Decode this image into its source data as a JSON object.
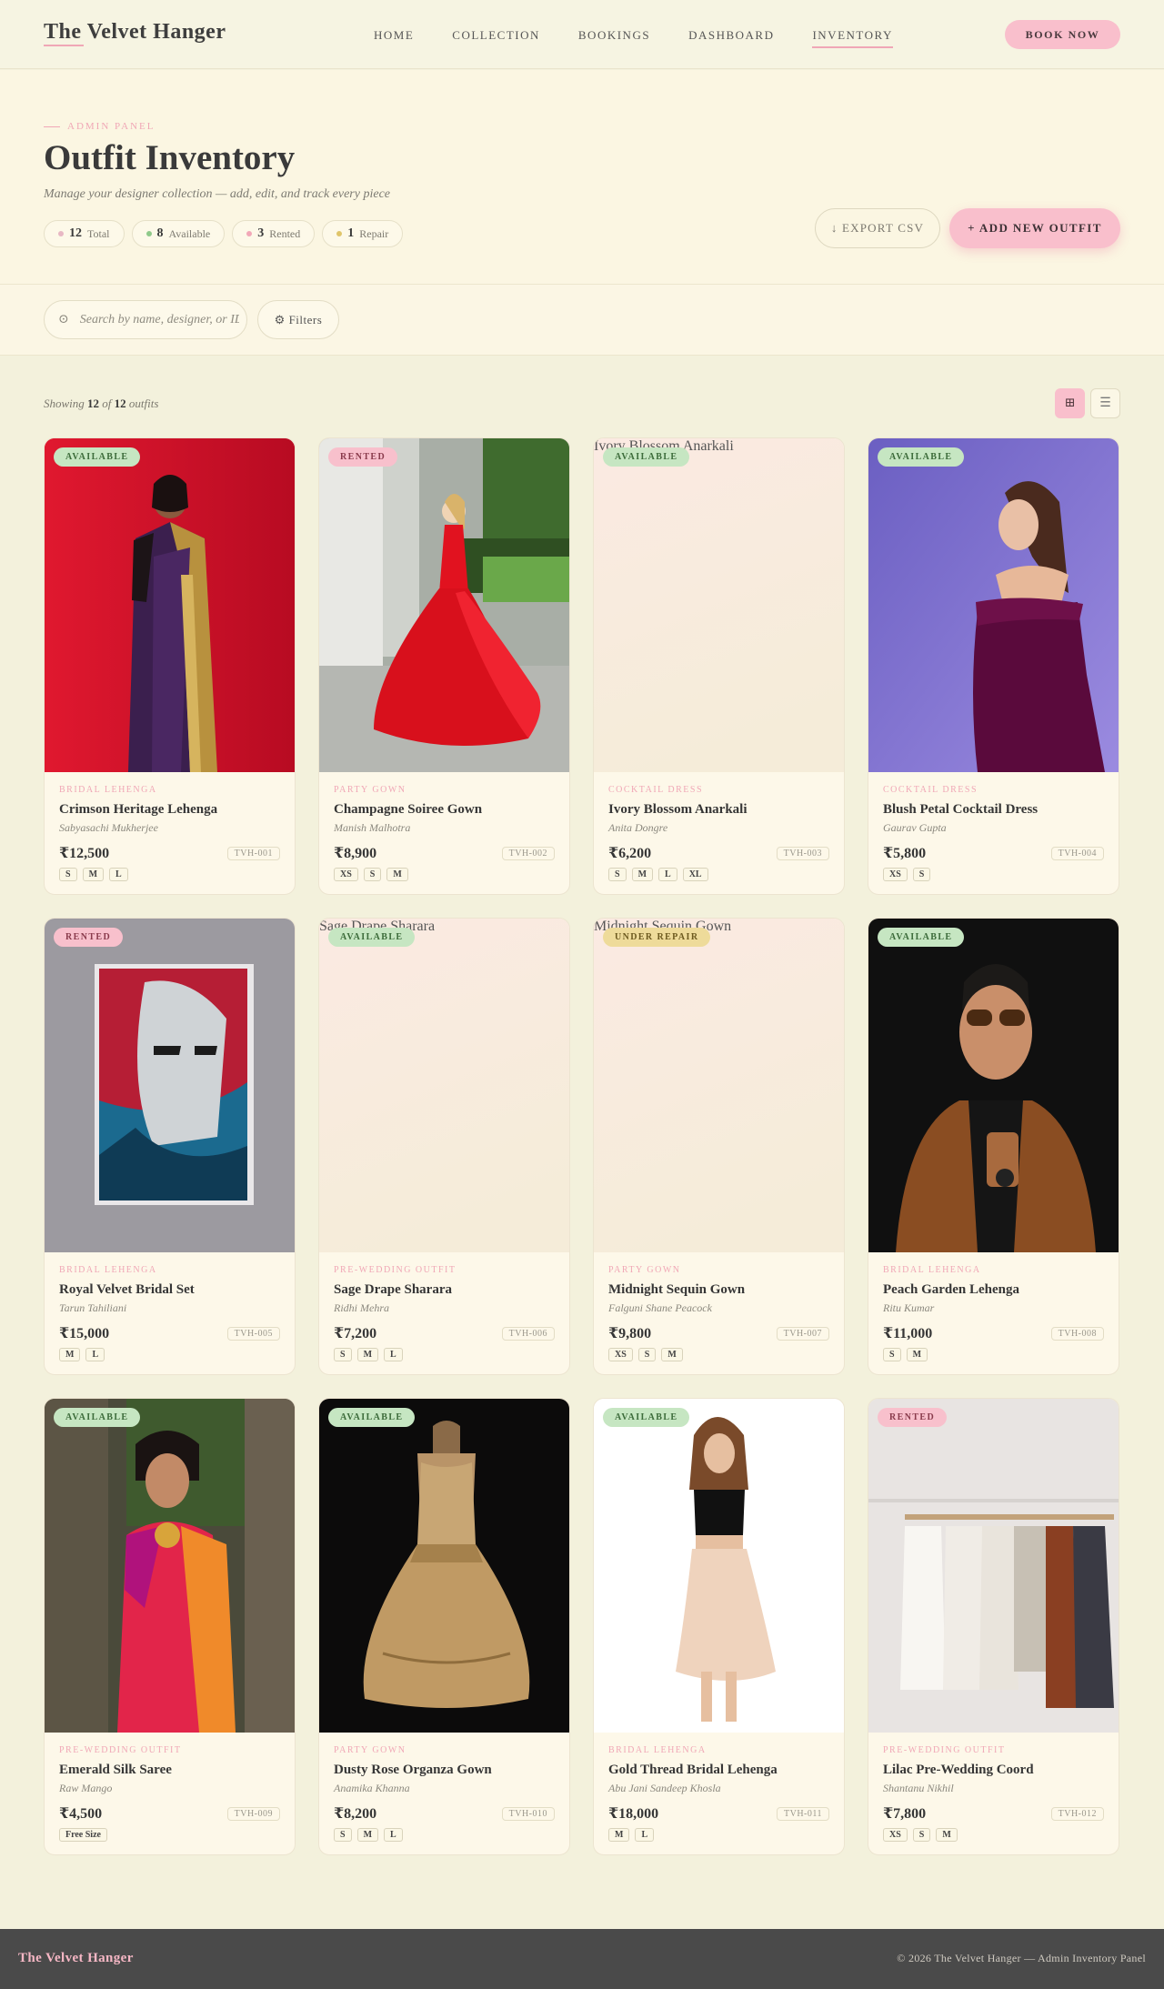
{
  "nav": {
    "brand": "The Velvet Hanger",
    "links": [
      "HOME",
      "COLLECTION",
      "BOOKINGS",
      "DASHBOARD",
      "INVENTORY"
    ],
    "active": "INVENTORY",
    "cta": "BOOK NOW"
  },
  "hero": {
    "eyebrow": "ADMIN PANEL",
    "title": "Outfit Inventory",
    "subtitle": "Manage your designer collection — add, edit, and track every piece",
    "stats": [
      {
        "value": "12",
        "label": "Total",
        "color": "#e8b8c4"
      },
      {
        "value": "8",
        "label": "Available",
        "color": "#8fc98a"
      },
      {
        "value": "3",
        "label": "Rented",
        "color": "#f2a8b8"
      },
      {
        "value": "1",
        "label": "Repair",
        "color": "#e0c56a"
      }
    ],
    "export_label": "↓ EXPORT CSV",
    "add_label": "+ ADD NEW OUTFIT"
  },
  "search": {
    "placeholder": "Search by name, designer, or ID...",
    "filters_label": "⚙ Filters"
  },
  "results": {
    "prefix": "Showing",
    "shown": "12",
    "of": "of",
    "total": "12",
    "suffix": "outfits",
    "view_modes": [
      {
        "icon": "grid-icon",
        "glyph": "⊞",
        "active": true
      },
      {
        "icon": "list-icon",
        "glyph": "☰",
        "active": false
      }
    ]
  },
  "outfits": [
    {
      "status": "AVAILABLE",
      "status_class": "available",
      "category": "BRIDAL LEHENGA",
      "name": "Crimson Heritage Lehenga",
      "designer": "Sabyasachi Mukherjee",
      "price": "₹12,500",
      "code": "TVH-001",
      "sizes": [
        "S",
        "M",
        "L"
      ],
      "image": "saree-red",
      "alt": ""
    },
    {
      "status": "RENTED",
      "status_class": "rented",
      "category": "PARTY GOWN",
      "name": "Champagne Soiree Gown",
      "designer": "Manish Malhotra",
      "price": "₹8,900",
      "code": "TVH-002",
      "sizes": [
        "XS",
        "S",
        "M"
      ],
      "image": "red-gown",
      "alt": ""
    },
    {
      "status": "AVAILABLE",
      "status_class": "available",
      "category": "COCKTAIL DRESS",
      "name": "Ivory Blossom Anarkali",
      "designer": "Anita Dongre",
      "price": "₹6,200",
      "code": "TVH-003",
      "sizes": [
        "S",
        "M",
        "L",
        "XL"
      ],
      "image": "broken",
      "alt": "Ivory Blossom Anarkali"
    },
    {
      "status": "AVAILABLE",
      "status_class": "available",
      "category": "COCKTAIL DRESS",
      "name": "Blush Petal Cocktail Dress",
      "designer": "Gaurav Gupta",
      "price": "₹5,800",
      "code": "TVH-004",
      "sizes": [
        "XS",
        "S"
      ],
      "image": "purple-dress",
      "alt": ""
    },
    {
      "status": "RENTED",
      "status_class": "rented",
      "category": "BRIDAL LEHENGA",
      "name": "Royal Velvet Bridal Set",
      "designer": "Tarun Tahiliani",
      "price": "₹15,000",
      "code": "TVH-005",
      "sizes": [
        "M",
        "L"
      ],
      "image": "poster",
      "alt": ""
    },
    {
      "status": "AVAILABLE",
      "status_class": "available",
      "category": "PRE-WEDDING OUTFIT",
      "name": "Sage Drape Sharara",
      "designer": "Ridhi Mehra",
      "price": "₹7,200",
      "code": "TVH-006",
      "sizes": [
        "S",
        "M",
        "L"
      ],
      "image": "broken",
      "alt": "Sage Drape Sharara"
    },
    {
      "status": "UNDER REPAIR",
      "status_class": "under-repair",
      "category": "PARTY GOWN",
      "name": "Midnight Sequin Gown",
      "designer": "Falguni Shane Peacock",
      "price": "₹9,800",
      "code": "TVH-007",
      "sizes": [
        "XS",
        "S",
        "M"
      ],
      "image": "broken",
      "alt": "Midnight Sequin Gown"
    },
    {
      "status": "AVAILABLE",
      "status_class": "available",
      "category": "BRIDAL LEHENGA",
      "name": "Peach Garden Lehenga",
      "designer": "Ritu Kumar",
      "price": "₹11,000",
      "code": "TVH-008",
      "sizes": [
        "S",
        "M"
      ],
      "image": "man-jacket",
      "alt": ""
    },
    {
      "status": "AVAILABLE",
      "status_class": "available",
      "category": "PRE-WEDDING OUTFIT",
      "name": "Emerald Silk Saree",
      "designer": "Raw Mango",
      "price": "₹4,500",
      "code": "TVH-009",
      "sizes": [
        "Free Size"
      ],
      "image": "saree-pink",
      "alt": ""
    },
    {
      "status": "AVAILABLE",
      "status_class": "available",
      "category": "PARTY GOWN",
      "name": "Dusty Rose Organza Gown",
      "designer": "Anamika Khanna",
      "price": "₹8,200",
      "code": "TVH-010",
      "sizes": [
        "S",
        "M",
        "L"
      ],
      "image": "gold-dress",
      "alt": ""
    },
    {
      "status": "AVAILABLE",
      "status_class": "available",
      "category": "BRIDAL LEHENGA",
      "name": "Gold Thread Bridal Lehenga",
      "designer": "Abu Jani Sandeep Khosla",
      "price": "₹18,000",
      "code": "TVH-011",
      "sizes": [
        "M",
        "L"
      ],
      "image": "skirt",
      "alt": ""
    },
    {
      "status": "RENTED",
      "status_class": "rented",
      "category": "PRE-WEDDING OUTFIT",
      "name": "Lilac Pre-Wedding Coord",
      "designer": "Shantanu Nikhil",
      "price": "₹7,800",
      "code": "TVH-012",
      "sizes": [
        "XS",
        "S",
        "M"
      ],
      "image": "rack",
      "alt": ""
    }
  ],
  "footer": {
    "brand": "The Velvet Hanger",
    "copy": "© 2026 The Velvet Hanger — Admin Inventory Panel"
  }
}
